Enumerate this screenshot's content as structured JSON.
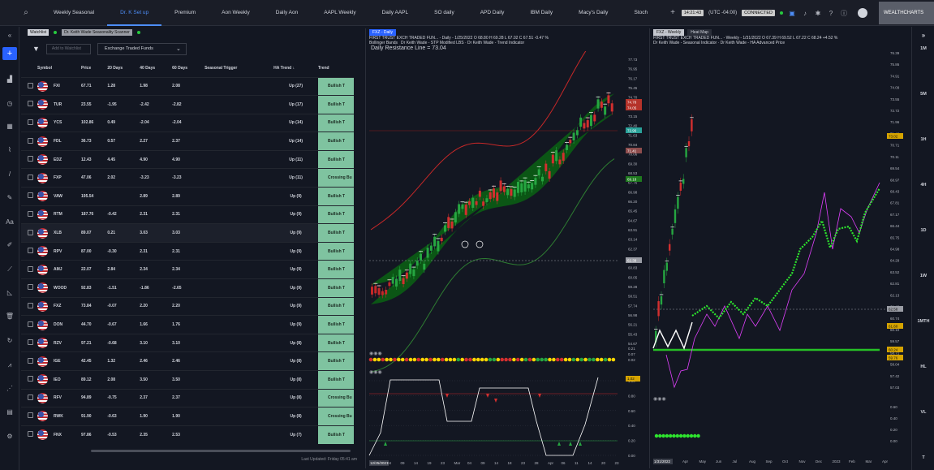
{
  "topbar": {
    "tabs": [
      "Weekly Seasonal",
      "Dr. K Set up",
      "Premium",
      "Aon Weekly",
      "Daily Aon",
      "AAPL Weekly",
      "Daily AAPL",
      "SO daily",
      "APD Daily",
      "IBM Daily",
      "Macy's Daily",
      "Stoch"
    ],
    "active_tab": 1,
    "clock": "14:21:43",
    "timezone": "(UTC -04:00)",
    "status_chip": "CONNECTED",
    "logo": "WEALTHCHARTS"
  },
  "watchlist": {
    "tab_watchlist": "Watchlist",
    "tab_scanner": "Dr. Keith Wade Seasonality Scanner",
    "add_placeholder": "Add to Watchlist",
    "group_select": "Exchange Traded Funds",
    "columns": [
      "Symbol",
      "Price",
      "20 Days",
      "40 Days",
      "60 Days",
      "Seasonal Trigger",
      "HA Trend ↓",
      "Trend"
    ],
    "rows": [
      [
        "FXI",
        "67.71",
        "1.28",
        "1.98",
        "2.08",
        "",
        "Up (27)",
        "Bullish T"
      ],
      [
        "TUR",
        "23.55",
        "-1.95",
        "-2.42",
        "-2.82",
        "",
        "Up (17)",
        "Bullish T"
      ],
      [
        "YCS",
        "102.86",
        "0.49",
        "-2.04",
        "-2.04",
        "",
        "Up (14)",
        "Bullish T"
      ],
      [
        "FDL",
        "36.73",
        "0.57",
        "2.27",
        "2.37",
        "",
        "Up (14)",
        "Bullish T"
      ],
      [
        "EDZ",
        "12.43",
        "4.45",
        "4.90",
        "4.90",
        "",
        "Up (11)",
        "Bullish T"
      ],
      [
        "FXP",
        "47.06",
        "2.02",
        "-3.23",
        "-3.23",
        "",
        "Up (11)",
        "Crossing Bu"
      ],
      [
        "VAW",
        "195.54",
        "",
        "2.89",
        "2.89",
        "",
        "Up (9)",
        "Bullish T"
      ],
      [
        "RTM",
        "187.76",
        "-0.42",
        "2.31",
        "2.31",
        "",
        "Up (9)",
        "Bullish T"
      ],
      [
        "XLB",
        "89.07",
        "0.21",
        "3.03",
        "3.03",
        "",
        "Up (9)",
        "Bullish T"
      ],
      [
        "RPV",
        "87.00",
        "-0.30",
        "2.31",
        "2.31",
        "",
        "Up (9)",
        "Bullish T"
      ],
      [
        "AMJ",
        "22.07",
        "2.84",
        "2.34",
        "2.34",
        "",
        "Up (9)",
        "Bullish T"
      ],
      [
        "WOOD",
        "92.83",
        "-1.51",
        "-1.86",
        "-2.65",
        "",
        "Up (9)",
        "Bullish T"
      ],
      [
        "FXZ",
        "73.84",
        "-0.07",
        "2.20",
        "2.20",
        "",
        "Up (9)",
        "Bullish T"
      ],
      [
        "DON",
        "44.70",
        "-0.67",
        "1.66",
        "1.76",
        "",
        "Up (9)",
        "Bullish T"
      ],
      [
        "RZV",
        "97.21",
        "-0.68",
        "3.10",
        "3.10",
        "",
        "Up (8)",
        "Bullish T"
      ],
      [
        "IGE",
        "42.45",
        "1.32",
        "2.46",
        "2.46",
        "",
        "Up (8)",
        "Bullish T"
      ],
      [
        "IEO",
        "89.12",
        "2.08",
        "3.50",
        "3.50",
        "",
        "Up (8)",
        "Bullish T"
      ],
      [
        "RFV",
        "94.89",
        "-0.75",
        "2.37",
        "2.37",
        "",
        "Up (8)",
        "Crossing Bu"
      ],
      [
        "RWK",
        "91.90",
        "-0.63",
        "1.90",
        "1.90",
        "",
        "Up (8)",
        "Crossing Bu"
      ],
      [
        "FNX",
        "97.86",
        "-0.53",
        "2.35",
        "2.53",
        "",
        "Up (7)",
        "Bullish T"
      ]
    ],
    "highlight_row": 8,
    "last_updated": "Last Updated: Friday 05:41 am"
  },
  "chart_daily": {
    "tab": "FXZ - Daily",
    "title": "FIRST TRUST EXCH TRADED FUN... - Daily - 1/25/2022 O 68.80 H 69.28 L 67.02 C 67.51 -0.47 %",
    "indicators": "Dr Keith Wade - STP Modified LBS · Dr Keith Wade - Trend Indicator",
    "bollinger": "Bollinger Bands",
    "resistance": "Daily Resistance Line = 73.04",
    "price_axis": [
      "77.73",
      "76.95",
      "76.17",
      "75.45",
      "74.70",
      "73.92",
      "73.15",
      "72.40",
      "71.63",
      "70.84",
      "70.06",
      "69.30",
      "68.53",
      "67.76",
      "66.98",
      "66.20",
      "65.45",
      "64.67",
      "63.91",
      "63.14",
      "62.37",
      "61.60",
      "60.83",
      "60.05",
      "59.28",
      "58.51",
      "57.74",
      "56.98",
      "56.21",
      "55.43",
      "54.67"
    ],
    "price_tags": [
      "74.78",
      "74.05",
      "72.96",
      "71.41",
      "69.18",
      "62.38"
    ],
    "dates": [
      "04",
      "09",
      "14",
      "19",
      "23",
      "Mar",
      "04",
      "09",
      "14",
      "18",
      "23",
      "28",
      "Apr",
      "06",
      "11",
      "14",
      "20",
      "23"
    ],
    "footer_date": "12/25/2021",
    "osc_axis": [
      "1.00",
      "0.80",
      "0.60",
      "0.40",
      "0.20",
      "0.00"
    ],
    "osc_tag": "1.02",
    "mid_axis": [
      "0.21",
      "0.07",
      "0.02"
    ]
  },
  "chart_weekly": {
    "tab": "FXZ - Weekly",
    "tab2": "Heat Map",
    "title": "FIRST TRUST EXCH TRADED FUN... - Weekly - 1/31/2022 O 67.39 H 69.52 L 67.22 C 68.24 +4.52 %",
    "indicators": "Dr Keith Wade - Seasonal Indicator · Dr Keith Wade - HA Advanced Price",
    "price_axis": [
      "76.39",
      "75.86",
      "74.91",
      "74.09",
      "73.55",
      "72.72",
      "71.96",
      "71.42",
      "70.71",
      "70.11",
      "69.54",
      "68.97",
      "68.43",
      "67.81",
      "67.17",
      "66.44",
      "65.75",
      "64.98",
      "64.29",
      "63.52",
      "62.81",
      "62.13",
      "61.49",
      "60.74",
      "60.10",
      "59.57",
      "58.71",
      "58.04",
      "57.42",
      "57.03"
    ],
    "price_tags": [
      "73.02",
      "62.58",
      "61.60",
      "60.24",
      "59.76"
    ],
    "dates": [
      "Apr",
      "May",
      "Jun",
      "Jul",
      "Aug",
      "Sep",
      "Oct",
      "Nov",
      "Dec",
      "2023",
      "Feb",
      "Mar",
      "Apr"
    ],
    "footer_date": "1/31/2022",
    "sub_axis": [
      "0.60",
      "0.40",
      "0.20",
      "0.00"
    ]
  },
  "rightbar": {
    "timeframes": [
      "1M",
      "5M",
      "1H",
      "4H",
      "1D",
      "1W",
      "1MTH",
      "HL",
      "VL",
      "T"
    ]
  }
}
